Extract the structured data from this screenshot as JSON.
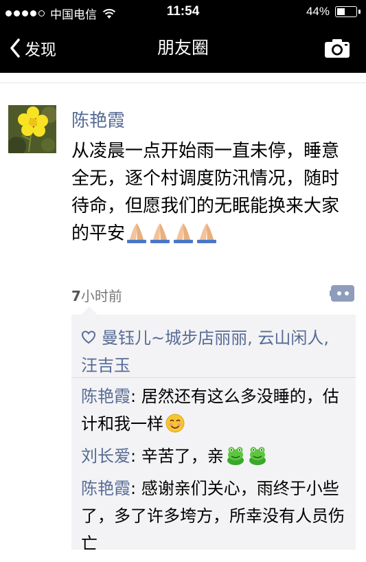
{
  "status_bar": {
    "carrier": "中国电信",
    "time": "11:54",
    "battery": "44%",
    "battery_level": 0.44
  },
  "nav": {
    "back_label": "发现",
    "title": "朋友圈"
  },
  "post": {
    "author": "陈艳霞",
    "text": "从凌晨一点开始雨一直未停，睡意全无，逐个村调度防汛情况，随时待命，但愿我们的无眠能换来大家的平安",
    "time_num": "7",
    "time_unit": "小时前"
  },
  "likes": {
    "names": [
      {
        "name": "曼钰儿~城步店丽丽",
        "sep": ", "
      },
      {
        "name": "云山闲人",
        "sep": ", "
      },
      {
        "name": "汪吉玉",
        "sep": ""
      }
    ]
  },
  "comments": [
    {
      "name": "陈艳霞",
      "sep": ": ",
      "text": "居然还有这么多没睡的，估计和我一样",
      "emoji": "smile"
    },
    {
      "name": "刘长爱",
      "sep": ": ",
      "text": "辛苦了，亲",
      "emoji": "frog"
    },
    {
      "name": "陈艳霞",
      "sep": ": ",
      "text": "感谢亲们关心，雨终于小些了，多了许多垮方，所幸没有人员伤亡",
      "emoji": ""
    }
  ],
  "colors": {
    "link": "#576b95",
    "bar_bg": "#000000",
    "panel_bg": "#f3f3f5"
  },
  "icons": [
    "signal-dots-icon",
    "wifi-icon",
    "battery-icon",
    "back-chevron-icon",
    "camera-icon",
    "pray-emoji-icon",
    "comment-more-icon",
    "heart-icon",
    "smile-emoji-icon",
    "frog-emoji-icon"
  ]
}
